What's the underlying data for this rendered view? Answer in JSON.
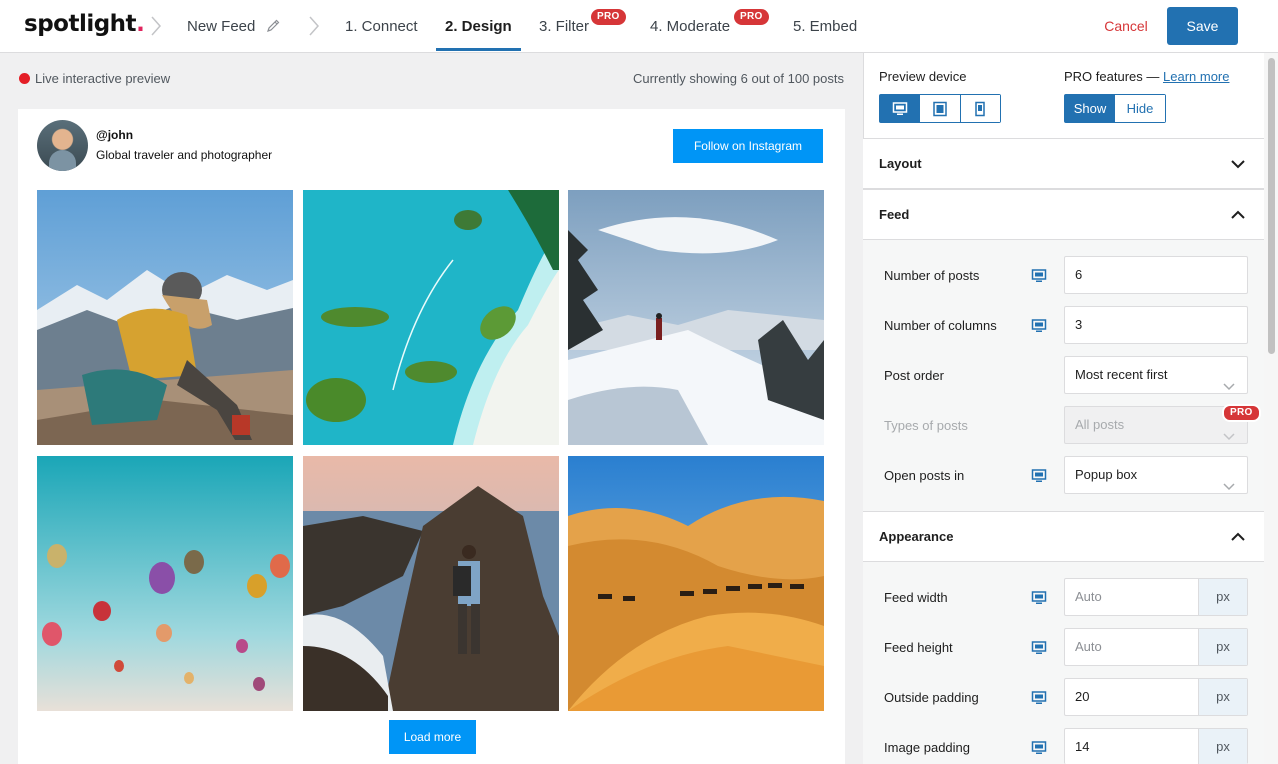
{
  "header": {
    "logo_text": "spotlight",
    "logo_dot": ".",
    "feed_name": "New Feed",
    "steps": [
      {
        "label": "1. Connect"
      },
      {
        "label": "2. Design"
      },
      {
        "label": "3. Filter",
        "badge": "PRO"
      },
      {
        "label": "4. Moderate",
        "badge": "PRO"
      },
      {
        "label": "5. Embed"
      }
    ],
    "cancel_label": "Cancel",
    "save_label": "Save"
  },
  "preview": {
    "live_label": "Live interactive preview",
    "showing_text": "Currently showing 6 out of 100 posts",
    "profile": {
      "username": "@john",
      "bio": "Global traveler and photographer",
      "follow_label": "Follow on Instagram"
    },
    "load_more_label": "Load more"
  },
  "sidebar": {
    "preview_device_label": "Preview device",
    "pro_features_label": "PRO features —",
    "learn_more_label": "Learn more",
    "show_label": "Show",
    "hide_label": "Hide",
    "sections": {
      "layout": "Layout",
      "feed": "Feed",
      "appearance": "Appearance"
    },
    "feed_fields": {
      "num_posts_label": "Number of posts",
      "num_posts_value": "6",
      "num_columns_label": "Number of columns",
      "num_columns_value": "3",
      "post_order_label": "Post order",
      "post_order_value": "Most recent first",
      "types_label": "Types of posts",
      "types_value": "All posts",
      "types_badge": "PRO",
      "open_in_label": "Open posts in",
      "open_in_value": "Popup box"
    },
    "appearance_fields": {
      "feed_width_label": "Feed width",
      "feed_width_placeholder": "Auto",
      "feed_height_label": "Feed height",
      "feed_height_placeholder": "Auto",
      "outside_padding_label": "Outside padding",
      "outside_padding_value": "20",
      "image_padding_label": "Image padding",
      "image_padding_value": "14",
      "unit": "px"
    }
  },
  "colors": {
    "accent": "#2271b1",
    "danger": "#d63638",
    "instagram_blue": "#0095f6"
  }
}
